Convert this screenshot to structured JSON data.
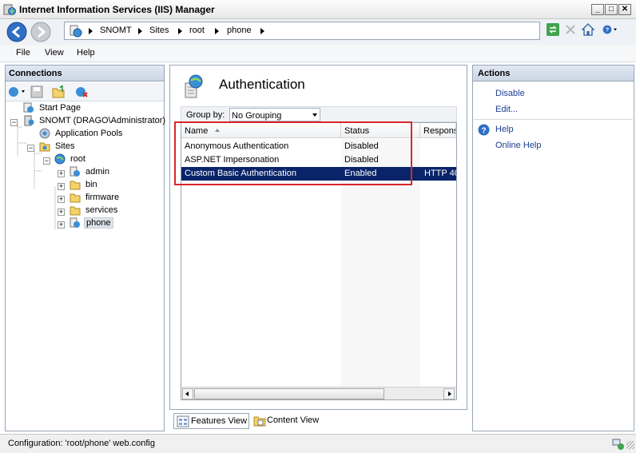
{
  "window": {
    "title": "Internet Information Services (IIS) Manager"
  },
  "address": {
    "crumbs": [
      "SNOMT",
      "Sites",
      "root",
      "phone"
    ]
  },
  "menu": {
    "items": [
      "File",
      "View",
      "Help"
    ]
  },
  "connections": {
    "header": "Connections",
    "tree": {
      "start_page": "Start Page",
      "server": "SNOMT (DRAGO\\Administrator)",
      "app_pools": "Application Pools",
      "sites": "Sites",
      "root": "root",
      "children": [
        "admin",
        "bin",
        "firmware",
        "services",
        "phone"
      ]
    }
  },
  "main": {
    "title": "Authentication",
    "group_by_label": "Group by:",
    "group_by_value": "No Grouping",
    "columns": [
      "Name",
      "Status",
      "Respons"
    ],
    "rows": [
      {
        "name": "Anonymous Authentication",
        "status": "Disabled",
        "response": ""
      },
      {
        "name": "ASP.NET Impersonation",
        "status": "Disabled",
        "response": ""
      },
      {
        "name": "Custom Basic Authentication",
        "status": "Enabled",
        "response": "HTTP 40"
      }
    ],
    "views": {
      "features": "Features View",
      "content": "Content View"
    }
  },
  "actions": {
    "header": "Actions",
    "disable": "Disable",
    "edit": "Edit...",
    "help": "Help",
    "online_help": "Online Help"
  },
  "status": {
    "text": "Configuration: 'root/phone' web.config"
  },
  "colors": {
    "selection": "#0a246a",
    "highlight_box": "#d9262b",
    "link": "#1b3d8f"
  }
}
